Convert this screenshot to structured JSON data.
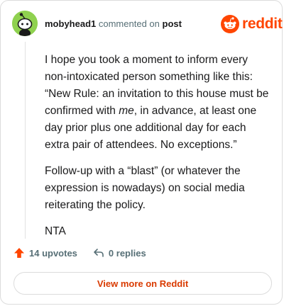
{
  "header": {
    "username": "mobyhead1",
    "action_text": "commented on",
    "post_link": "post",
    "brand": "reddit"
  },
  "comment": {
    "paragraph1_before": "I hope you took a moment to inform every non-intoxicated person something like this: “New Rule: an invitation to this house must be confirmed with ",
    "paragraph1_em": "me",
    "paragraph1_after": ", in advance, at least one day prior plus one additional day for each extra pair of attendees. No exceptions.”",
    "paragraph2": "Follow-up with a “blast” (or whatever the expression is nowadays) on social media reiterating the policy.",
    "paragraph3": "NTA"
  },
  "footer": {
    "upvotes": "14 upvotes",
    "replies": "0 replies",
    "view_more": "View more on Reddit"
  },
  "icons": {
    "avatar": "snoo-avatar-icon",
    "brand_logo": "reddit-snoo-logo-icon",
    "upvote": "upvote-arrow-icon",
    "reply": "reply-arrow-icon"
  },
  "colors": {
    "brand": "#ff4500",
    "upvote": "#ff4500",
    "link": "#d93a00",
    "avatar_bg": "#8fd14f",
    "muted": "#576f76"
  }
}
